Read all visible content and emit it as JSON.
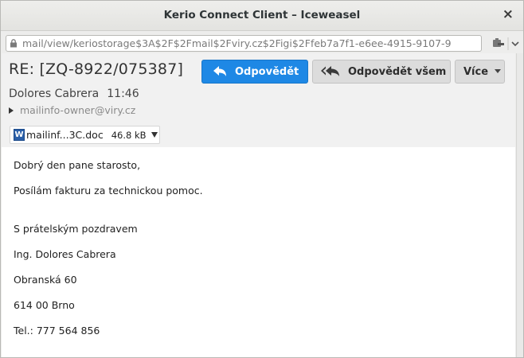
{
  "window": {
    "title": "Kerio Connect Client – Iceweasel",
    "close_glyph": "×"
  },
  "urlbar": {
    "url": "mail/view/keriostorage$3A$2F$2Fmail$2Fviry.cz$2Figi$2Ffeb7a7f1-e6ee-4915-9107-9",
    "lock_icon": "lock-icon",
    "extra_icons": [
      "addon-icon",
      "dropdown-chevron-icon"
    ]
  },
  "message": {
    "subject": "RE: [ZQ-8922/075387]",
    "sender_name": "Dolores Cabrera",
    "time": "11:46",
    "from_address": "mailinfo-owner@viry.cz"
  },
  "toolbar": {
    "reply_label": "Odpovědět",
    "reply_all_label": "Odpovědět všem",
    "more_label": "Více",
    "accent_color": "#1e88e5"
  },
  "attachment": {
    "icon": "word-doc-icon",
    "icon_letter": "W",
    "name": "mailinf...3C.doc",
    "size": "46.8 kB"
  },
  "body": {
    "lines": [
      "Dobrý den pane starosto,",
      "Posílám fakturu za technickou pomoc.",
      "S prátelským pozdravem",
      "Ing. Dolores Cabrera",
      "Obranská 60",
      "614 00 Brno",
      "Tel.: 777 564 856"
    ]
  }
}
